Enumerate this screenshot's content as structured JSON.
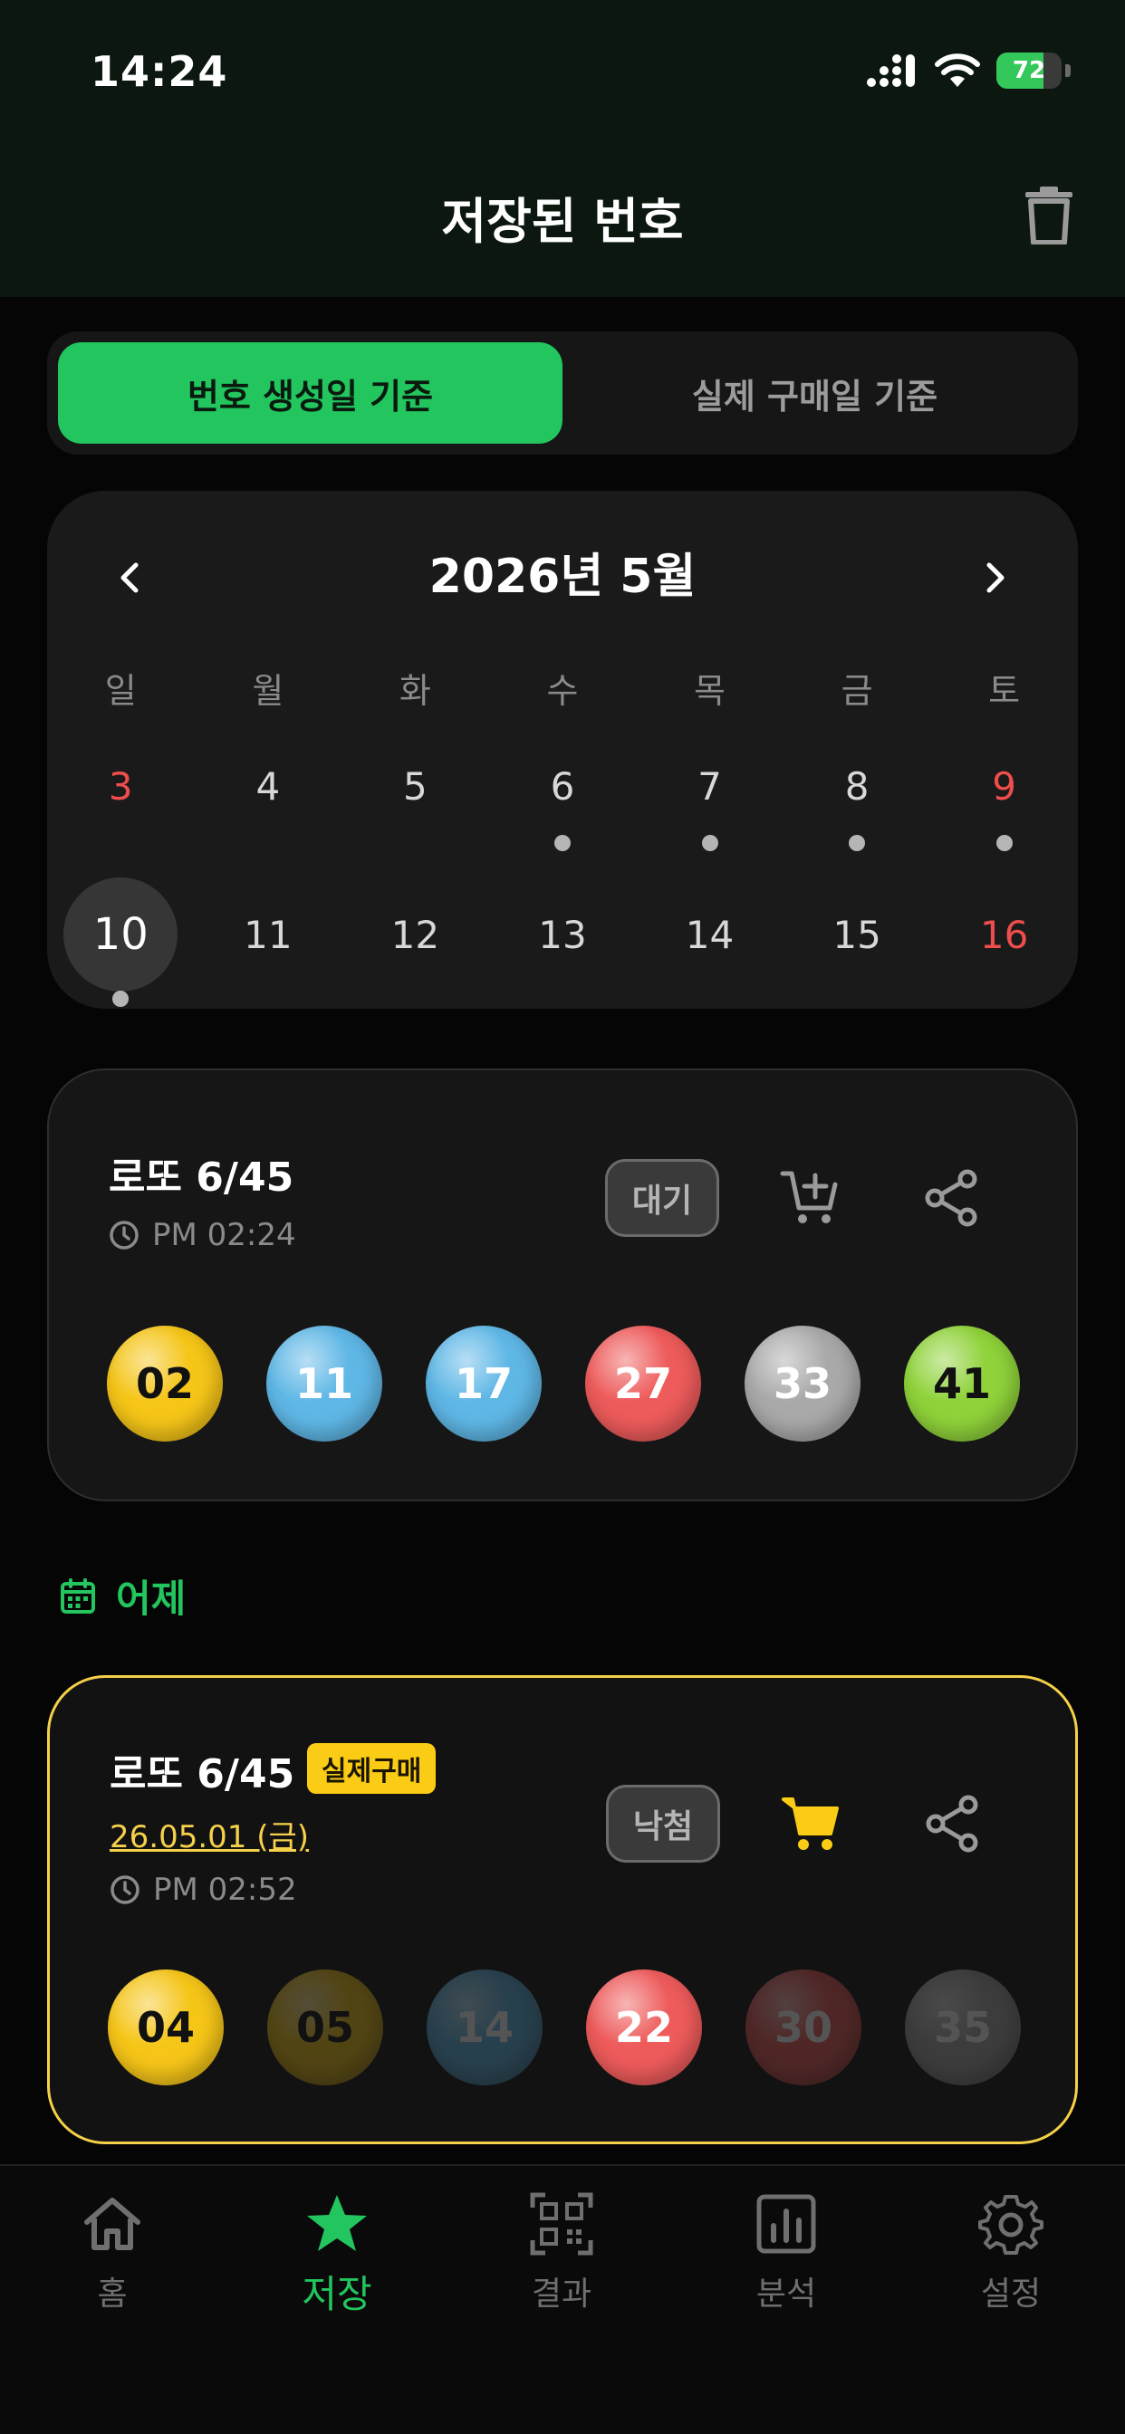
{
  "status_bar": {
    "time": "14:24",
    "battery": "72",
    "battery_level_percent": 72
  },
  "header": {
    "title": "저장된 번호",
    "trash_icon": "trash-icon"
  },
  "toggle": {
    "options": [
      "번호 생성일 기준",
      "실제 구매일 기준"
    ],
    "selected": 0
  },
  "calendar": {
    "month_label": "2026년 5월",
    "weekdays": [
      "일",
      "월",
      "화",
      "수",
      "목",
      "금",
      "토"
    ],
    "weeks": [
      [
        {
          "day": "3",
          "dot": false,
          "red": true
        },
        {
          "day": "4",
          "dot": false,
          "red": false
        },
        {
          "day": "5",
          "dot": false,
          "red": false
        },
        {
          "day": "6",
          "dot": true,
          "red": false
        },
        {
          "day": "7",
          "dot": true,
          "red": false
        },
        {
          "day": "8",
          "dot": true,
          "red": false
        },
        {
          "day": "9",
          "dot": true,
          "red": true
        }
      ],
      [
        {
          "day": "10",
          "dot": true,
          "red": false,
          "selected": true
        },
        {
          "day": "11",
          "dot": false,
          "red": false
        },
        {
          "day": "12",
          "dot": false,
          "red": false
        },
        {
          "day": "13",
          "dot": false,
          "red": false
        },
        {
          "day": "14",
          "dot": false,
          "red": false
        },
        {
          "day": "15",
          "dot": false,
          "red": false
        },
        {
          "day": "16",
          "dot": false,
          "red": true
        }
      ]
    ]
  },
  "tickets": [
    {
      "title": "로또 6/45",
      "time": "PM 02:24",
      "status": "대기",
      "purchased": false,
      "balls": [
        {
          "n": "02",
          "color": "#f5c518",
          "text": "#111111",
          "dim": false
        },
        {
          "n": "11",
          "color": "#5fb7e6",
          "text": "#ffffff",
          "dim": false
        },
        {
          "n": "17",
          "color": "#5fb7e6",
          "text": "#ffffff",
          "dim": false
        },
        {
          "n": "27",
          "color": "#ee5b5b",
          "text": "#ffffff",
          "dim": false
        },
        {
          "n": "33",
          "color": "#a9a9a9",
          "text": "#ffffff",
          "dim": false
        },
        {
          "n": "41",
          "color": "#8fd23a",
          "text": "#111111",
          "dim": false
        }
      ]
    },
    {
      "title": "로또 6/45",
      "badge": "실제구매",
      "purchase_date": "26.05.01 (금)",
      "time": "PM 02:52",
      "status": "낙첨",
      "purchased": true,
      "balls": [
        {
          "n": "04",
          "color": "#f5c518",
          "text": "#111111",
          "dim": false
        },
        {
          "n": "05",
          "color": "#f5c518",
          "text": "#111111",
          "dim": true
        },
        {
          "n": "14",
          "color": "#5fb7e6",
          "text": "#ffffff",
          "dim": true
        },
        {
          "n": "22",
          "color": "#ee5b5b",
          "text": "#ffffff",
          "dim": false
        },
        {
          "n": "30",
          "color": "#ee5b5b",
          "text": "#ffffff",
          "dim": true
        },
        {
          "n": "35",
          "color": "#a9a9a9",
          "text": "#ffffff",
          "dim": true
        }
      ]
    }
  ],
  "section": {
    "label": "어제",
    "icon": "calendar-icon"
  },
  "tab_bar": {
    "tabs": [
      {
        "label": "홈",
        "icon": "home-icon"
      },
      {
        "label": "저장",
        "icon": "star-icon",
        "active": true
      },
      {
        "label": "결과",
        "icon": "qr-scan-icon"
      },
      {
        "label": "분석",
        "icon": "chart-icon"
      },
      {
        "label": "설정",
        "icon": "gear-icon"
      }
    ]
  },
  "colors": {
    "accent": "#22c55e",
    "highlight": "#facc15",
    "background": "#050505"
  }
}
